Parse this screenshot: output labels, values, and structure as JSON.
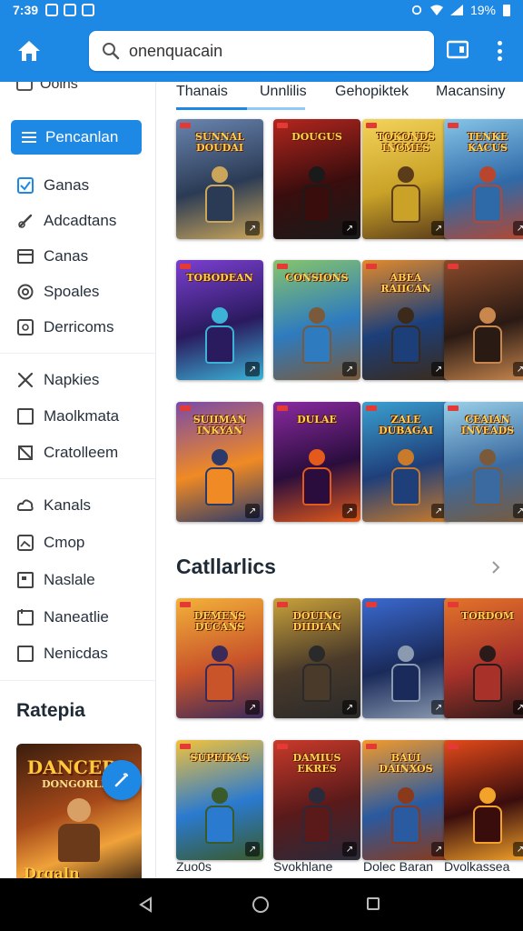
{
  "status_bar": {
    "time": "7:39",
    "battery": "19%"
  },
  "app_bar": {
    "search_value": "onenquacain"
  },
  "sidebar": {
    "top_item": "Ooins",
    "primary": "Pencanlan",
    "items": [
      {
        "label": "Ganas",
        "icon": "checkbox-icon"
      },
      {
        "label": "Adcadtans",
        "icon": "link-icon"
      },
      {
        "label": "Canas",
        "icon": "card-icon"
      },
      {
        "label": "Spoales",
        "icon": "clock-icon"
      },
      {
        "label": "Derricoms",
        "icon": "photo-icon"
      },
      {
        "label": "Napkies",
        "icon": "tools-icon"
      },
      {
        "label": "Maolkmata",
        "icon": "square-icon"
      },
      {
        "label": "Cratolleem",
        "icon": "puzzle-icon"
      },
      {
        "label": "Kanals",
        "icon": "cloud-icon"
      },
      {
        "label": "Cmop",
        "icon": "image-icon"
      },
      {
        "label": "Naslale",
        "icon": "frame-icon"
      },
      {
        "label": "Naneatlie",
        "icon": "calendar-icon"
      },
      {
        "label": "Nenicdas",
        "icon": "square-icon"
      }
    ],
    "section_title": "Ratepia",
    "feature": {
      "title": "DANCERA",
      "subtitle": "DONGORLEA",
      "bottom": "Drgaln"
    }
  },
  "tabs": [
    "Thanais",
    "Unnlilis",
    "Gehopiktek",
    "Macansiny"
  ],
  "grid_titles": [
    "SUNNAL DOUDAI",
    "DOUGUS",
    "TOKONDS INCMES",
    "TENKE KACUS",
    "TOBODEAN",
    "CONSIONS",
    "ABEA RAIICAN",
    "",
    "SUIIMAN INKYAN",
    "DULAE",
    "ZALE DUBAGAI",
    "CEAIAN INVEADS"
  ],
  "section_title": "Catllarlics",
  "section_titles_2": [
    "DEMENS DUCANS",
    "DOUING DIIDIAN",
    "",
    "TORDOM",
    "SUPEIKAS",
    "DAMIUS EKRES",
    "BAUI DAINXOS",
    ""
  ],
  "captions": [
    "Zuo0s",
    "Svokhlane",
    "Dolec Baran",
    "Dvolkassea"
  ],
  "colors": {
    "accent": "#1e88e5"
  }
}
